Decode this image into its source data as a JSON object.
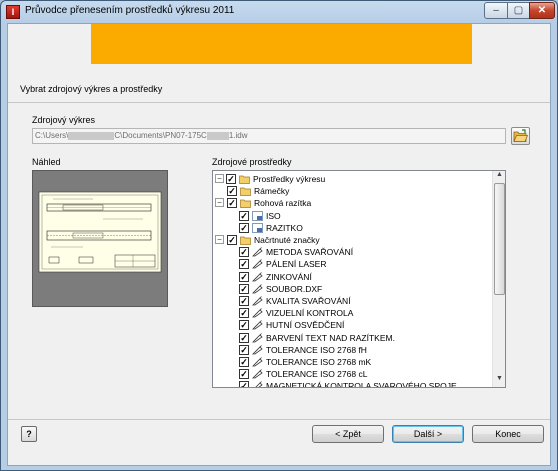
{
  "window": {
    "title": "Průvodce přenesením prostředků výkresu 2011",
    "app_icon": "I",
    "controls": {
      "minimize": "–",
      "maximize": "▢",
      "close": "✕"
    }
  },
  "step": {
    "title": "Vybrat zdrojový výkres a prostředky"
  },
  "source": {
    "label": "Zdrojový výkres",
    "path_prefix": "C:\\Users\\",
    "path_middle": "C\\Documents\\PN07-175C",
    "path_suffix": "1.idw"
  },
  "preview": {
    "label": "Náhled"
  },
  "resources": {
    "label": "Zdrojové prostředky",
    "root": "Prostředky výkresu",
    "items": [
      {
        "label": "Rámečky",
        "level": 1,
        "icon": "folder-icon",
        "expander": ""
      },
      {
        "label": "Rohová razítka",
        "level": 1,
        "icon": "folder-icon",
        "expander": "−"
      },
      {
        "label": "ISO",
        "level": 2,
        "icon": "titleblock-icon",
        "expander": ""
      },
      {
        "label": "RAZITKO",
        "level": 2,
        "icon": "titleblock-icon",
        "expander": ""
      },
      {
        "label": "Načrtnuté značky",
        "level": 1,
        "icon": "folder-icon",
        "expander": "−"
      },
      {
        "label": "METODA SVAŘOVÁNÍ",
        "level": 2,
        "icon": "sketched-symbol-icon",
        "expander": ""
      },
      {
        "label": "PÁLENÍ LASER",
        "level": 2,
        "icon": "sketched-symbol-icon",
        "expander": ""
      },
      {
        "label": "ZINKOVÁNÍ",
        "level": 2,
        "icon": "sketched-symbol-icon",
        "expander": ""
      },
      {
        "label": "SOUBOR.DXF",
        "level": 2,
        "icon": "sketched-symbol-icon",
        "expander": ""
      },
      {
        "label": "KVALITA SVAŘOVÁNÍ",
        "level": 2,
        "icon": "sketched-symbol-icon",
        "expander": ""
      },
      {
        "label": "VIZUELNÍ KONTROLA",
        "level": 2,
        "icon": "sketched-symbol-icon",
        "expander": ""
      },
      {
        "label": "HUTNÍ OSVĚDČENÍ",
        "level": 2,
        "icon": "sketched-symbol-icon",
        "expander": ""
      },
      {
        "label": "BARVENÍ TEXT NAD RAZÍTKEM.",
        "level": 2,
        "icon": "sketched-symbol-icon",
        "expander": ""
      },
      {
        "label": "TOLERANCE ISO 2768 fH",
        "level": 2,
        "icon": "sketched-symbol-icon",
        "expander": ""
      },
      {
        "label": "TOLERANCE ISO 2768 mK",
        "level": 2,
        "icon": "sketched-symbol-icon",
        "expander": ""
      },
      {
        "label": "TOLERANCE ISO 2768 cL",
        "level": 2,
        "icon": "sketched-symbol-icon",
        "expander": ""
      },
      {
        "label": "MAGNETICKÁ KONTROLA SVAROVÉHO SPOJE",
        "level": 2,
        "icon": "sketched-symbol-icon",
        "expander": ""
      }
    ]
  },
  "buttons": {
    "back": "< Zpět",
    "next": "Další >",
    "finish": "Konec",
    "help": "?"
  },
  "colors": {
    "banner": "#fbab00",
    "window_frame": "#b6cde6",
    "client": "#f0f0f0"
  }
}
